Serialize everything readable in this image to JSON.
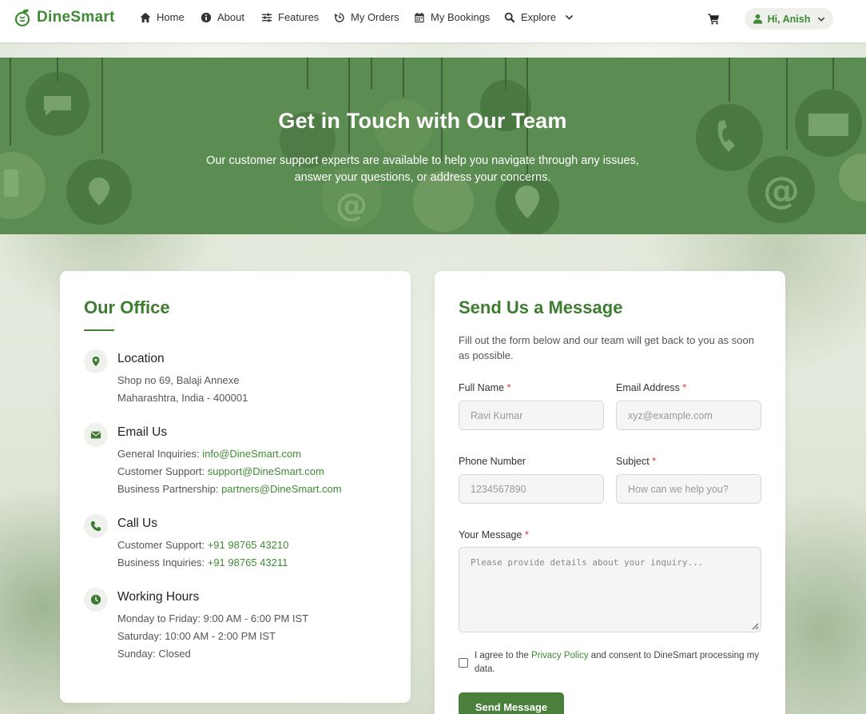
{
  "brand": {
    "name": "DineSmart",
    "color": "#3e8a34"
  },
  "nav": {
    "items": [
      {
        "label": "Home",
        "icon": "home-icon"
      },
      {
        "label": "About",
        "icon": "info-icon"
      },
      {
        "label": "Features",
        "icon": "sliders-icon"
      },
      {
        "label": "My Orders",
        "icon": "history-icon"
      },
      {
        "label": "My Bookings",
        "icon": "calendar-icon"
      },
      {
        "label": "Explore",
        "icon": "search-icon"
      }
    ],
    "cart_icon": "cart-icon",
    "user_label": "Hi, Anish"
  },
  "hero": {
    "title": "Get in Touch with Our Team",
    "subtitle": "Our customer support experts are available to help you navigate through any issues, answer your questions, or address your concerns."
  },
  "office": {
    "title": "Our Office",
    "sections": [
      {
        "title": "Location",
        "icon": "map-pin-icon",
        "lines": [
          {
            "text": "Shop no 69, Balaji Annexe",
            "link": ""
          },
          {
            "text": "Maharashtra, India - 400001",
            "link": ""
          }
        ]
      },
      {
        "title": "Email Us",
        "icon": "envelope-icon",
        "lines": [
          {
            "text": "General Inquiries: ",
            "link": "info@DineSmart.com"
          },
          {
            "text": "Customer Support: ",
            "link": "support@DineSmart.com"
          },
          {
            "text": "Business Partnership: ",
            "link": "partners@DineSmart.com"
          }
        ]
      },
      {
        "title": "Call Us",
        "icon": "phone-icon",
        "lines": [
          {
            "text": "Customer Support: ",
            "link": "+91 98765 43210"
          },
          {
            "text": "Business Inquiries: ",
            "link": "+91 98765 43211"
          }
        ]
      },
      {
        "title": "Working Hours",
        "icon": "clock-icon",
        "lines": [
          {
            "text": "Monday to Friday: 9:00 AM - 6:00 PM IST",
            "link": ""
          },
          {
            "text": "Saturday: 10:00 AM - 2:00 PM IST",
            "link": ""
          },
          {
            "text": "Sunday: Closed",
            "link": ""
          }
        ]
      }
    ]
  },
  "form": {
    "title": "Send Us a Message",
    "description": "Fill out the form below and our team will get back to you as soon as possible.",
    "required_mark": "*",
    "full_name": {
      "label": "Full Name",
      "placeholder": "Ravi Kumar"
    },
    "email": {
      "label": "Email Address",
      "placeholder": "xyz@example.com"
    },
    "phone": {
      "label": "Phone Number",
      "placeholder": "1234567890"
    },
    "subject": {
      "label": "Subject",
      "placeholder": "How can we help you?"
    },
    "message": {
      "label": "Your Message",
      "placeholder": "Please provide details about your inquiry..."
    },
    "agree_prefix": "I agree to the ",
    "agree_link": "Privacy Policy",
    "agree_suffix": " and consent to DineSmart processing my data.",
    "submit_label": "Send Message"
  }
}
